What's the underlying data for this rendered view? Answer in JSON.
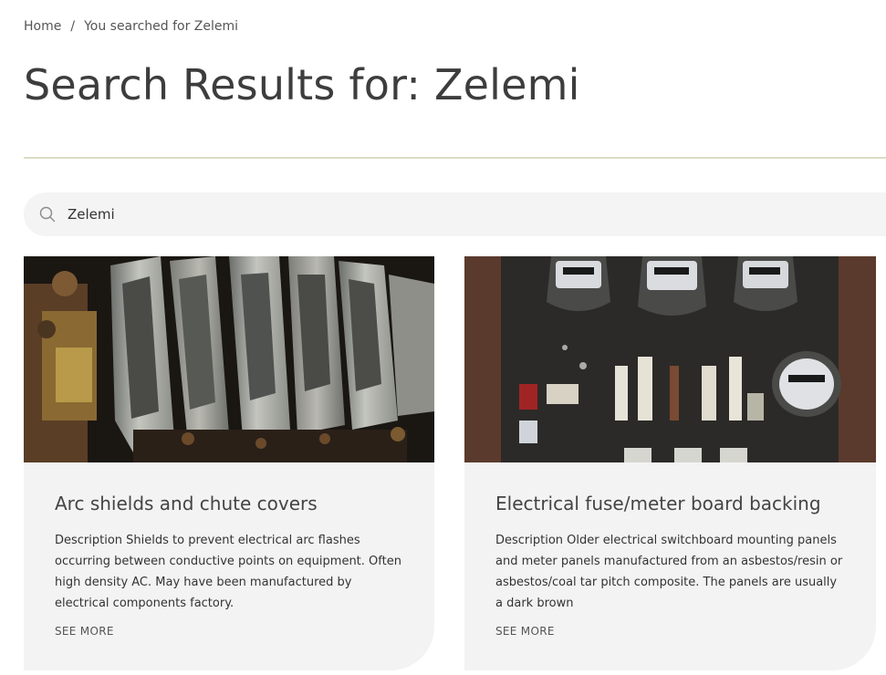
{
  "breadcrumb": {
    "home": "Home",
    "separator": "/",
    "current": "You searched for Zelemi"
  },
  "page": {
    "title": "Search Results for: Zelemi"
  },
  "search": {
    "value": "Zelemi",
    "icon": "search-icon"
  },
  "results": [
    {
      "title": "Arc shields and chute covers",
      "description": "Description Shields to prevent electrical arc flashes occurring between conductive points on equipment. Often high density AC. May have been manufactured by electrical components factory.",
      "link": "SEE MORE"
    },
    {
      "title": "Electrical fuse/meter board backing",
      "description": "Description Older electrical switchboard mounting panels and meter panels manufactured from an asbestos/resin or asbestos/coal tar pitch composite. The panels are usually a dark brown",
      "link": "SEE MORE"
    }
  ],
  "colors": {
    "divider": "#dcdcc6",
    "card_bg": "#f3f3f3",
    "search_bg": "#f4f4f4",
    "title_text": "#3d3d3d"
  }
}
